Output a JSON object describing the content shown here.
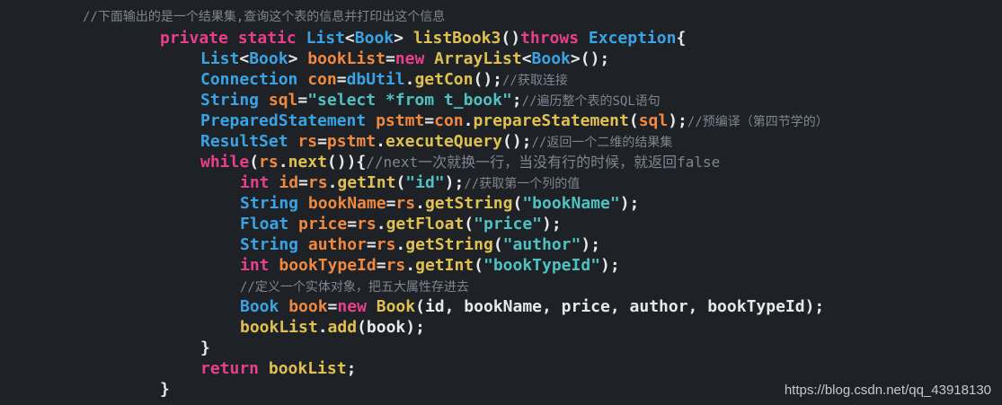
{
  "colors": {
    "background": "#1e2227",
    "keyword": "#e83e8c",
    "type": "#3aa3e3",
    "variable": "#f0883e",
    "method": "#e0c050",
    "string": "#4fc1c1",
    "plain": "#e8e8e8",
    "comment": "#7f8590"
  },
  "code": {
    "lines": [
      {
        "indent": 0,
        "tokens": [
          {
            "t": "//下面输出的是一个结果集,查询这个表的信息并打印出这个信息",
            "k": "comment"
          }
        ]
      },
      {
        "indent": 1,
        "tokens": [
          {
            "t": "private static ",
            "k": "keyword"
          },
          {
            "t": "List",
            "k": "type"
          },
          {
            "t": "<",
            "k": "plain"
          },
          {
            "t": "Book",
            "k": "type"
          },
          {
            "t": "> ",
            "k": "plain"
          },
          {
            "t": "listBook3",
            "k": "method"
          },
          {
            "t": "()",
            "k": "plain"
          },
          {
            "t": "throws ",
            "k": "keyword"
          },
          {
            "t": "Exception",
            "k": "type"
          },
          {
            "t": "{",
            "k": "plain"
          }
        ]
      },
      {
        "indent": 2,
        "tokens": [
          {
            "t": "List",
            "k": "type"
          },
          {
            "t": "<",
            "k": "plain"
          },
          {
            "t": "Book",
            "k": "type"
          },
          {
            "t": "> ",
            "k": "plain"
          },
          {
            "t": "bookList",
            "k": "variable"
          },
          {
            "t": "=",
            "k": "plain"
          },
          {
            "t": "new ",
            "k": "keyword"
          },
          {
            "t": "ArrayList",
            "k": "method"
          },
          {
            "t": "<",
            "k": "plain"
          },
          {
            "t": "Book",
            "k": "type"
          },
          {
            "t": ">();",
            "k": "plain"
          }
        ]
      },
      {
        "indent": 2,
        "tokens": [
          {
            "t": "Connection ",
            "k": "type"
          },
          {
            "t": "con",
            "k": "variable"
          },
          {
            "t": "=",
            "k": "plain"
          },
          {
            "t": "dbUtil",
            "k": "type"
          },
          {
            "t": ".",
            "k": "plain"
          },
          {
            "t": "getCon",
            "k": "method"
          },
          {
            "t": "();",
            "k": "plain"
          },
          {
            "t": "//获取连接",
            "k": "comment"
          }
        ]
      },
      {
        "indent": 2,
        "tokens": [
          {
            "t": "String ",
            "k": "type"
          },
          {
            "t": "sql",
            "k": "variable"
          },
          {
            "t": "=",
            "k": "plain"
          },
          {
            "t": "\"select *from t_book\"",
            "k": "string"
          },
          {
            "t": ";",
            "k": "plain"
          },
          {
            "t": "//遍历整个表的SQL语句",
            "k": "comment"
          }
        ]
      },
      {
        "indent": 2,
        "tokens": [
          {
            "t": "PreparedStatement ",
            "k": "type"
          },
          {
            "t": "pstmt",
            "k": "variable"
          },
          {
            "t": "=",
            "k": "plain"
          },
          {
            "t": "con",
            "k": "variable"
          },
          {
            "t": ".",
            "k": "plain"
          },
          {
            "t": "prepareStatement",
            "k": "method"
          },
          {
            "t": "(",
            "k": "plain"
          },
          {
            "t": "sql",
            "k": "variable"
          },
          {
            "t": ");",
            "k": "plain"
          },
          {
            "t": "//预编译（第四节学的）",
            "k": "comment"
          }
        ]
      },
      {
        "indent": 2,
        "tokens": [
          {
            "t": "ResultSet ",
            "k": "type"
          },
          {
            "t": "rs",
            "k": "variable"
          },
          {
            "t": "=",
            "k": "plain"
          },
          {
            "t": "pstmt",
            "k": "variable"
          },
          {
            "t": ".",
            "k": "plain"
          },
          {
            "t": "executeQuery",
            "k": "method"
          },
          {
            "t": "();",
            "k": "plain"
          },
          {
            "t": "//返回一个二维的结果集",
            "k": "comment"
          }
        ]
      },
      {
        "indent": 2,
        "tokens": [
          {
            "t": "while",
            "k": "keyword"
          },
          {
            "t": "(",
            "k": "plain"
          },
          {
            "t": "rs",
            "k": "variable"
          },
          {
            "t": ".",
            "k": "plain"
          },
          {
            "t": "next",
            "k": "method"
          },
          {
            "t": "()){",
            "k": "plain"
          },
          {
            "t": "//next一次就换一行，当没有行的时候，就返回false",
            "k": "commentlong"
          }
        ]
      },
      {
        "indent": 3,
        "tokens": [
          {
            "t": "int ",
            "k": "keyword"
          },
          {
            "t": "id",
            "k": "variable"
          },
          {
            "t": "=",
            "k": "plain"
          },
          {
            "t": "rs",
            "k": "variable"
          },
          {
            "t": ".",
            "k": "plain"
          },
          {
            "t": "getInt",
            "k": "method"
          },
          {
            "t": "(",
            "k": "plain"
          },
          {
            "t": "\"id\"",
            "k": "string"
          },
          {
            "t": ");",
            "k": "plain"
          },
          {
            "t": "//获取第一个列的值",
            "k": "comment"
          }
        ]
      },
      {
        "indent": 3,
        "tokens": [
          {
            "t": "String ",
            "k": "type"
          },
          {
            "t": "bookName",
            "k": "variable"
          },
          {
            "t": "=",
            "k": "plain"
          },
          {
            "t": "rs",
            "k": "variable"
          },
          {
            "t": ".",
            "k": "plain"
          },
          {
            "t": "getString",
            "k": "method"
          },
          {
            "t": "(",
            "k": "plain"
          },
          {
            "t": "\"bookName\"",
            "k": "string"
          },
          {
            "t": ");",
            "k": "plain"
          }
        ]
      },
      {
        "indent": 3,
        "tokens": [
          {
            "t": "Float ",
            "k": "type"
          },
          {
            "t": "price",
            "k": "variable"
          },
          {
            "t": "=",
            "k": "plain"
          },
          {
            "t": "rs",
            "k": "variable"
          },
          {
            "t": ".",
            "k": "plain"
          },
          {
            "t": "getFloat",
            "k": "method"
          },
          {
            "t": "(",
            "k": "plain"
          },
          {
            "t": "\"price\"",
            "k": "string"
          },
          {
            "t": ");",
            "k": "plain"
          }
        ]
      },
      {
        "indent": 3,
        "tokens": [
          {
            "t": "String ",
            "k": "type"
          },
          {
            "t": "author",
            "k": "variable"
          },
          {
            "t": "=",
            "k": "plain"
          },
          {
            "t": "rs",
            "k": "variable"
          },
          {
            "t": ".",
            "k": "plain"
          },
          {
            "t": "getString",
            "k": "method"
          },
          {
            "t": "(",
            "k": "plain"
          },
          {
            "t": "\"author\"",
            "k": "string"
          },
          {
            "t": ");",
            "k": "plain"
          }
        ]
      },
      {
        "indent": 3,
        "tokens": [
          {
            "t": "int ",
            "k": "keyword"
          },
          {
            "t": "bookTypeId",
            "k": "variable"
          },
          {
            "t": "=",
            "k": "plain"
          },
          {
            "t": "rs",
            "k": "variable"
          },
          {
            "t": ".",
            "k": "plain"
          },
          {
            "t": "getInt",
            "k": "method"
          },
          {
            "t": "(",
            "k": "plain"
          },
          {
            "t": "\"bookTypeId\"",
            "k": "string"
          },
          {
            "t": ");",
            "k": "plain"
          }
        ]
      },
      {
        "indent": 3,
        "tokens": [
          {
            "t": "//定义一个实体对象，把五大属性存进去",
            "k": "comment"
          }
        ]
      },
      {
        "indent": 3,
        "tokens": [
          {
            "t": "Book ",
            "k": "type"
          },
          {
            "t": "book",
            "k": "variable"
          },
          {
            "t": "=",
            "k": "plain"
          },
          {
            "t": "new ",
            "k": "keyword"
          },
          {
            "t": "Book",
            "k": "method"
          },
          {
            "t": "(id, bookName, price, author, bookTypeId);",
            "k": "plain"
          }
        ]
      },
      {
        "indent": 3,
        "tokens": [
          {
            "t": "bookList",
            "k": "method"
          },
          {
            "t": ".",
            "k": "plain"
          },
          {
            "t": "add",
            "k": "method"
          },
          {
            "t": "(book);",
            "k": "plain"
          }
        ]
      },
      {
        "indent": 2,
        "tokens": [
          {
            "t": "}",
            "k": "plain"
          }
        ]
      },
      {
        "indent": 2,
        "tokens": [
          {
            "t": "return ",
            "k": "keyword"
          },
          {
            "t": "bookList",
            "k": "method"
          },
          {
            "t": ";",
            "k": "plain"
          }
        ]
      },
      {
        "indent": 1,
        "tokens": [
          {
            "t": "}",
            "k": "plain"
          }
        ]
      }
    ]
  },
  "watermark": "https://blog.csdn.net/qq_43918130"
}
